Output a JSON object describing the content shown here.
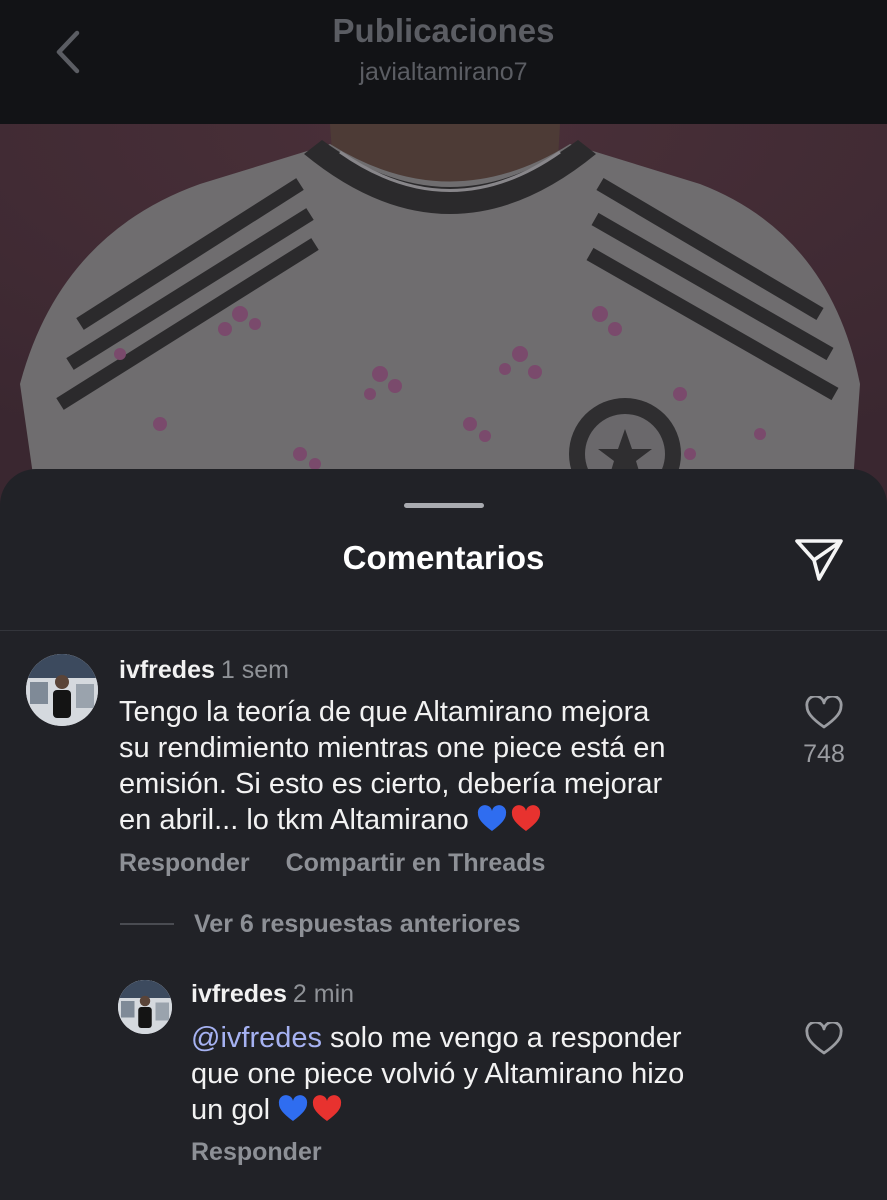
{
  "header": {
    "title": "Publicaciones",
    "subtitle": "javialtamirano7"
  },
  "sheet": {
    "title": "Comentarios"
  },
  "comments": [
    {
      "username": "ivfredes",
      "time": "1 sem",
      "text_lines": [
        "Tengo la teoría de que Altamirano mejora",
        "su rendimiento mientras one piece está en",
        "emisión. Si esto es cierto, debería mejorar",
        "en abril... lo tkm Altamirano"
      ],
      "emojis": [
        "💙",
        "❤️"
      ],
      "like_count": "748",
      "actions": {
        "reply": "Responder",
        "share": "Compartir en Threads"
      }
    }
  ],
  "view_replies": "Ver 6 respuestas anteriores",
  "replies": [
    {
      "username": "ivfredes",
      "time": "2 min",
      "mention": "@ivfredes",
      "text_lines": [
        "solo me vengo a responder",
        "que one piece volvió y Altamirano hizo",
        "un gol"
      ],
      "emojis": [
        "💙",
        "❤️"
      ],
      "actions": {
        "reply": "Responder"
      }
    }
  ],
  "colors": {
    "sheet_bg": "#212227",
    "header_bg": "#121316",
    "mention": "#a6b2f2",
    "secondary_text": "#8d9096",
    "emoji_blue": "#2f6df0",
    "emoji_red": "#e8322f"
  },
  "icons": {
    "back": "chevron-left-icon",
    "share": "paper-plane-icon",
    "like": "heart-outline-icon"
  }
}
